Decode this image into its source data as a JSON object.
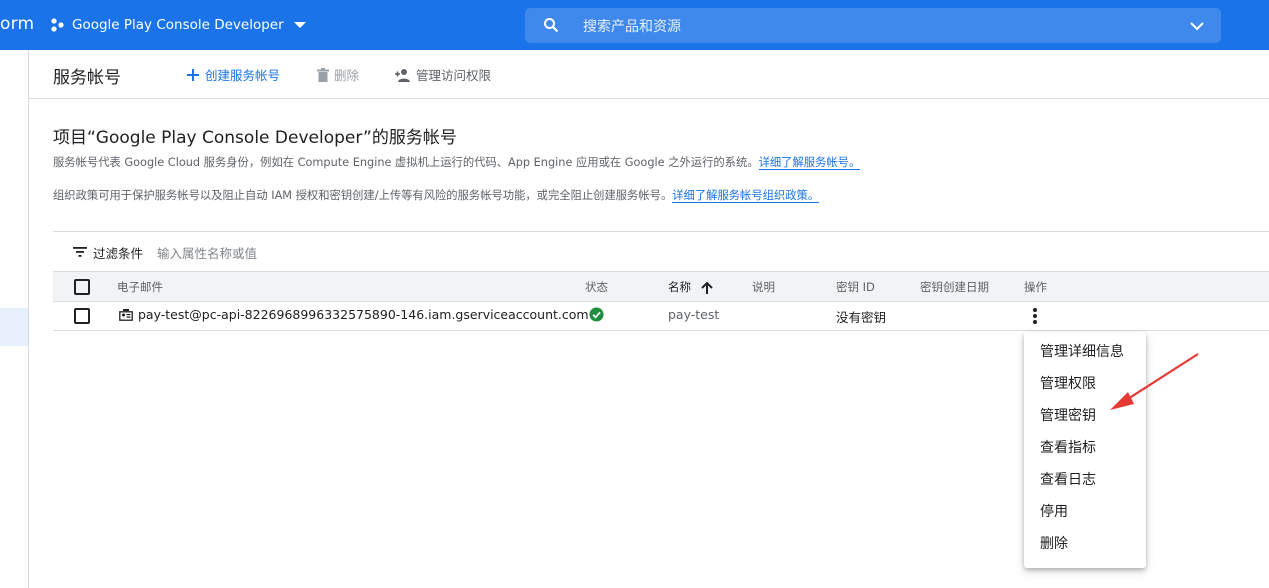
{
  "colors": {
    "header_bg": "#1a73e8",
    "accent": "#1a73e8",
    "status_ok": "#1e8e3e",
    "annotation_arrow": "#e53935"
  },
  "topbar": {
    "brand_fragment": "orm",
    "project_name": "Google Play Console Developer",
    "search_placeholder": "搜索产品和资源"
  },
  "page_header": {
    "title": "服务帐号",
    "create_label": "创建服务帐号",
    "delete_label": "删除",
    "manage_access_label": "管理访问权限"
  },
  "content": {
    "section_title": "项目“Google Play Console Developer”的服务帐号",
    "desc1_text": "服务帐号代表 Google Cloud 服务身份，例如在 Compute Engine 虚拟机上运行的代码、App Engine 应用或在 Google 之外运行的系统。",
    "desc1_link": "详细了解服务帐号。",
    "desc2_text": "组织政策可用于保护服务帐号以及阻止自动 IAM 授权和密钥创建/上传等有风险的服务帐号功能，或完全阻止创建服务帐号。",
    "desc2_link": "详细了解服务帐号组织政策。"
  },
  "filter": {
    "label": "过滤条件",
    "placeholder": "输入属性名称或值"
  },
  "table": {
    "columns": {
      "email": "电子邮件",
      "status": "状态",
      "name": "名称",
      "description": "说明",
      "key_id": "密钥 ID",
      "key_created": "密钥创建日期",
      "actions": "操作"
    },
    "sort_column": "名称",
    "rows": [
      {
        "email": "pay-test@pc-api-8226968996332575890-146.iam.gserviceaccount.com",
        "status_icon": "check-circle-icon",
        "name": "pay-test",
        "description": "",
        "key_id": "没有密钥",
        "key_created": ""
      }
    ]
  },
  "action_menu": {
    "items": [
      "管理详细信息",
      "管理权限",
      "管理密钥",
      "查看指标",
      "查看日志",
      "停用",
      "删除"
    ],
    "highlighted_item": "管理密钥"
  }
}
